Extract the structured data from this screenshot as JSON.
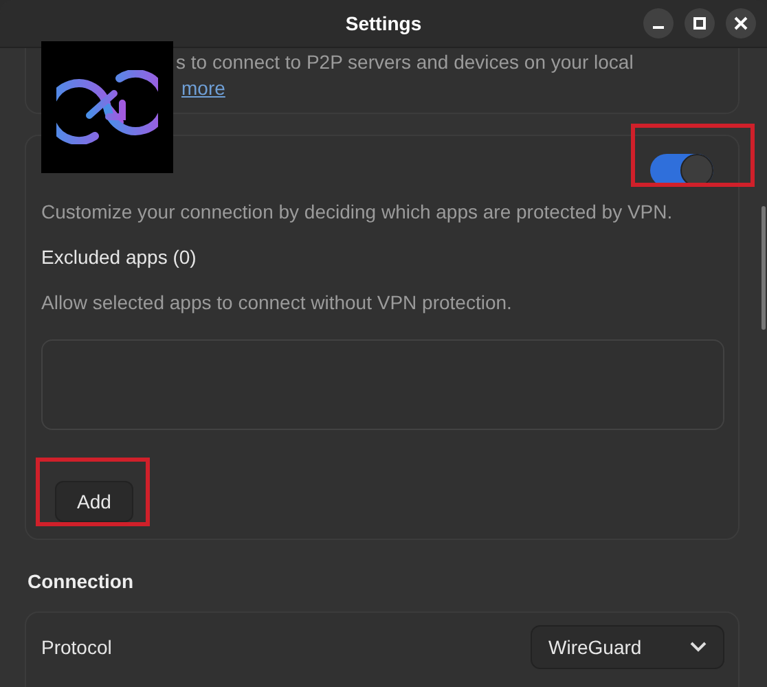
{
  "window": {
    "title": "Settings"
  },
  "network_card": {
    "description": "s to connect to P2P servers and devices on your local",
    "link": "more"
  },
  "split_tunneling": {
    "toggle_on": true,
    "description": "Customize your connection by deciding which apps are protected by VPN.",
    "excluded_apps_title": "Excluded apps (0)",
    "excluded_apps_hint": "Allow selected apps to connect without VPN protection.",
    "add_button": "Add"
  },
  "connection": {
    "heading": "Connection",
    "protocol_label": "Protocol",
    "protocol_value": "WireGuard"
  }
}
